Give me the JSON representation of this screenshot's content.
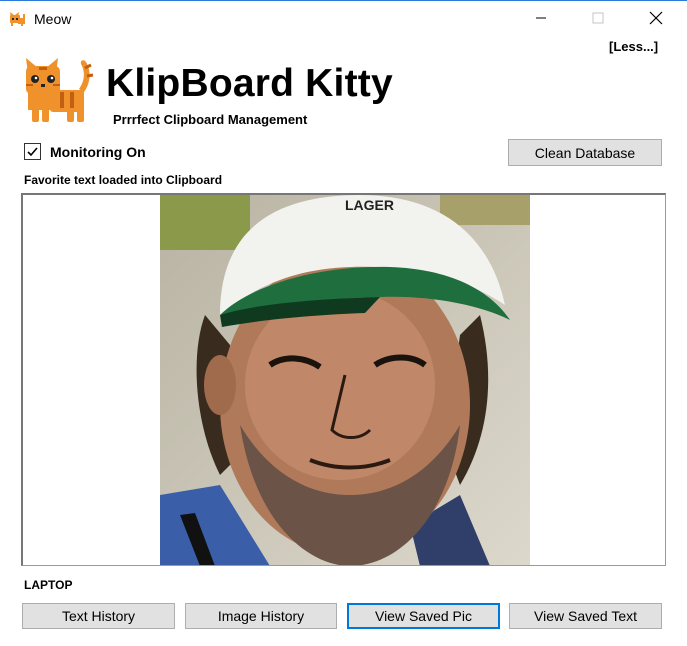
{
  "window": {
    "title": "Meow",
    "icon": "cat-icon",
    "controls": [
      "minimize-icon",
      "maximize-icon",
      "close-icon"
    ]
  },
  "header": {
    "less_link": "[Less...]",
    "logo": "cat-logo",
    "title": "KlipBoard Kitty",
    "subtitle": "Prrrfect Clipboard Management"
  },
  "monitoring": {
    "label": "Monitoring On",
    "checked": true
  },
  "clean_button": "Clean Database",
  "status": "Favorite text loaded into Clipboard",
  "preview": {
    "image": "clipboard-photo"
  },
  "device_name": "LAPTOP",
  "buttons": {
    "text_history": "Text History",
    "image_history": "Image History",
    "view_saved_pic": "View Saved Pic",
    "view_saved_text": "View Saved Text"
  },
  "colors": {
    "accent": "#0078d7",
    "button_bg": "#e1e1e1",
    "cat_orange": "#f0922c"
  }
}
